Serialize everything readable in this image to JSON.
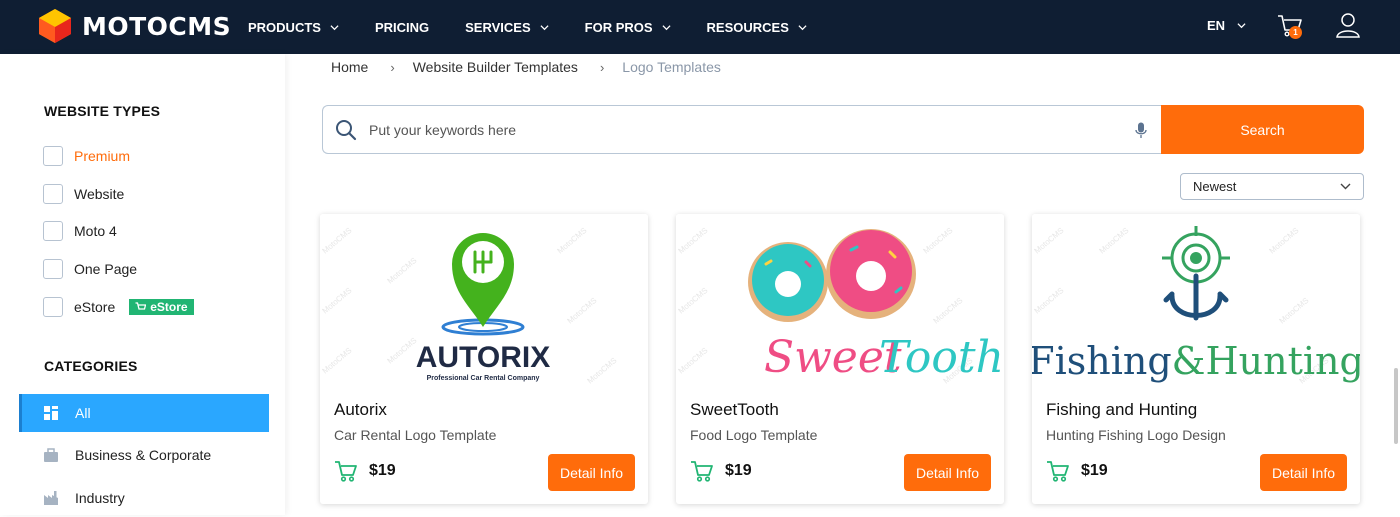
{
  "header": {
    "brand": "MOTOCMS",
    "nav": [
      {
        "label": "PRODUCTS",
        "has_dropdown": true
      },
      {
        "label": "PRICING",
        "has_dropdown": false
      },
      {
        "label": "SERVICES",
        "has_dropdown": true
      },
      {
        "label": "FOR PROS",
        "has_dropdown": true
      },
      {
        "label": "RESOURCES",
        "has_dropdown": true
      }
    ],
    "language": "EN",
    "cart_count": "1",
    "colors": {
      "bg": "#0f1e33",
      "accent": "#ff6c0b"
    }
  },
  "sidebar": {
    "website_types_title": "WEBSITE TYPES",
    "website_types": [
      {
        "label": "Premium",
        "checked": false
      },
      {
        "label": "Website",
        "checked": false
      },
      {
        "label": "Moto 4",
        "checked": false
      },
      {
        "label": "One Page",
        "checked": false
      },
      {
        "label": "eStore",
        "checked": false,
        "badge": "eStore"
      }
    ],
    "categories_title": "CATEGORIES",
    "categories": [
      {
        "label": "All",
        "icon": "grid-icon",
        "active": true
      },
      {
        "label": "Business & Corporate",
        "icon": "briefcase-icon",
        "active": false
      },
      {
        "label": "Industry",
        "icon": "factory-icon",
        "active": false
      }
    ]
  },
  "breadcrumb": [
    "Home",
    "Website Builder Templates",
    "Logo Templates"
  ],
  "search": {
    "placeholder": "Put your keywords here",
    "value": "",
    "button_label": "Search"
  },
  "sort": {
    "selected": "Newest"
  },
  "products": [
    {
      "title": "Autorix",
      "subtitle": "Car Rental Logo Template",
      "price": "$19",
      "button": "Detail Info",
      "logo_text": "AUTORIX",
      "logo_tagline": "Professional Car Rental Company"
    },
    {
      "title": "SweetTooth",
      "subtitle": "Food Logo Template",
      "price": "$19",
      "button": "Detail Info",
      "logo_text": "SweetTooth"
    },
    {
      "title": "Fishing and Hunting",
      "subtitle": "Hunting Fishing Logo Design",
      "price": "$19",
      "button": "Detail Info",
      "logo_text": "Fishing&Hunting"
    }
  ],
  "watermark": "MotoCMS"
}
